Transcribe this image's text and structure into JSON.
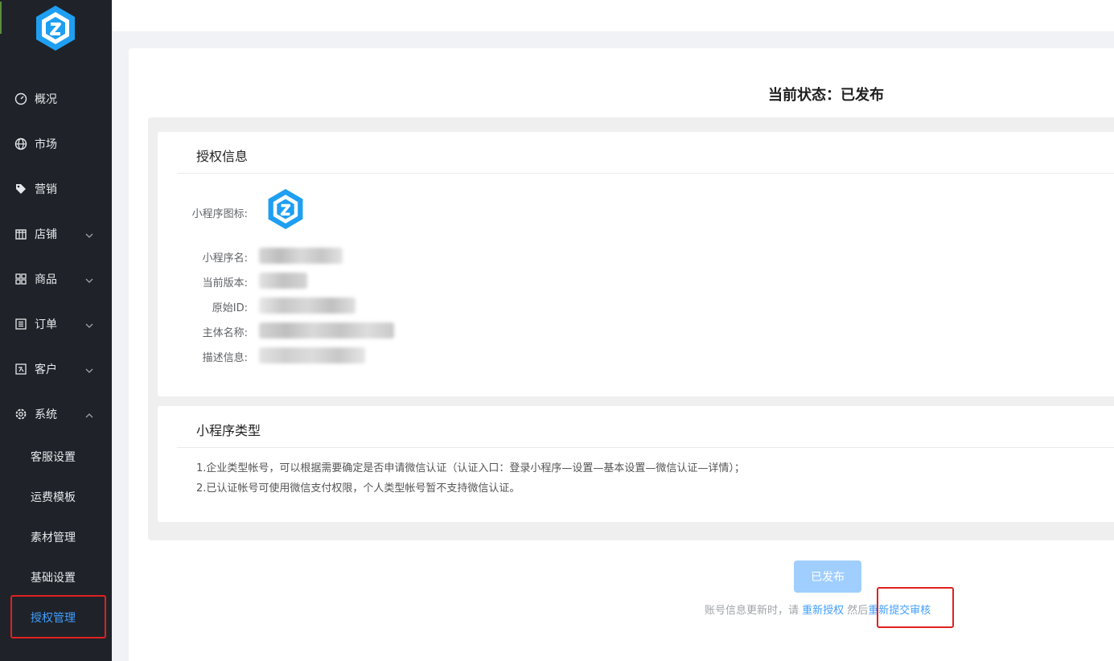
{
  "sidebar": {
    "items": [
      {
        "label": "概况",
        "icon": "dashboard-icon"
      },
      {
        "label": "市场",
        "icon": "globe-icon"
      },
      {
        "label": "营销",
        "icon": "tag-icon"
      },
      {
        "label": "店铺",
        "icon": "store-icon",
        "expandable": true
      },
      {
        "label": "商品",
        "icon": "grid-icon",
        "expandable": true
      },
      {
        "label": "订单",
        "icon": "list-icon",
        "expandable": true
      },
      {
        "label": "客户",
        "icon": "customer-icon",
        "expandable": true
      },
      {
        "label": "系统",
        "icon": "gear-icon",
        "expanded": true
      }
    ],
    "sub_items": [
      {
        "label": "客服设置"
      },
      {
        "label": "运费模板"
      },
      {
        "label": "素材管理"
      },
      {
        "label": "基础设置"
      },
      {
        "label": "授权管理",
        "active": true
      }
    ]
  },
  "main": {
    "status": "当前状态：已发布",
    "auth_info": {
      "title": "授权信息",
      "labels": {
        "icon": "小程序图标:",
        "name": "小程序名:",
        "version": "当前版本:",
        "original_id": "原始ID:",
        "entity": "主体名称:",
        "description": "描述信息:"
      }
    },
    "type_section": {
      "title": "小程序类型",
      "lines": [
        "1.企业类型帐号，可以根据需要确定是否申请微信认证（认证入口：登录小程序—设置—基本设置—微信认证—详情）；",
        "2.已认证帐号可使用微信支付权限，个人类型帐号暂不支持微信认证。"
      ]
    },
    "publish_button": "已发布",
    "hint": {
      "prefix": "账号信息更新时，请 ",
      "reauth": "重新授权",
      "middle": " 然后",
      "resubmit": "重新提交审核"
    }
  },
  "colors": {
    "sidebar_bg": "#1f2329",
    "accent": "#409eff",
    "disabled_button": "#a0cfff",
    "highlight": "#e02020",
    "logo": "#1e9ff2"
  }
}
